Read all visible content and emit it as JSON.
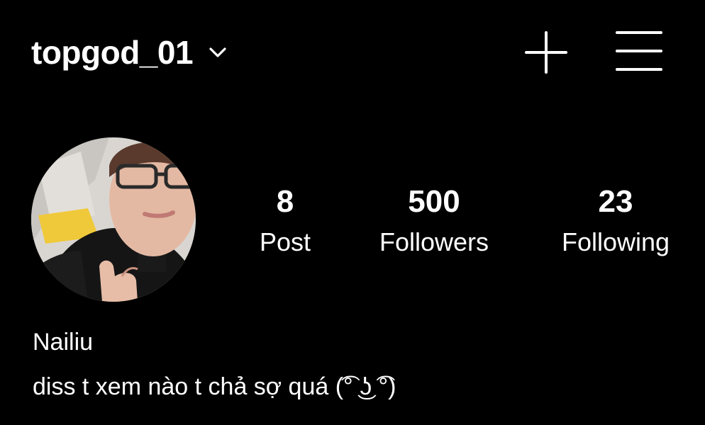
{
  "header": {
    "username": "topgod_01",
    "switch_account_icon": "chevron-down-icon",
    "create_icon": "plus-icon",
    "menu_icon": "hamburger-menu-icon"
  },
  "profile": {
    "avatar": "profile-photo",
    "stats": {
      "posts": {
        "count": "8",
        "label": "Post"
      },
      "followers": {
        "count": "500",
        "label": "Followers"
      },
      "following": {
        "count": "23",
        "label": "Following"
      }
    },
    "name": "Nailiu",
    "bio": "diss t xem nào t chả sợ quá (͡° ͜ʖ ͡°)"
  },
  "colors": {
    "background": "#000000",
    "text": "#ffffff"
  }
}
